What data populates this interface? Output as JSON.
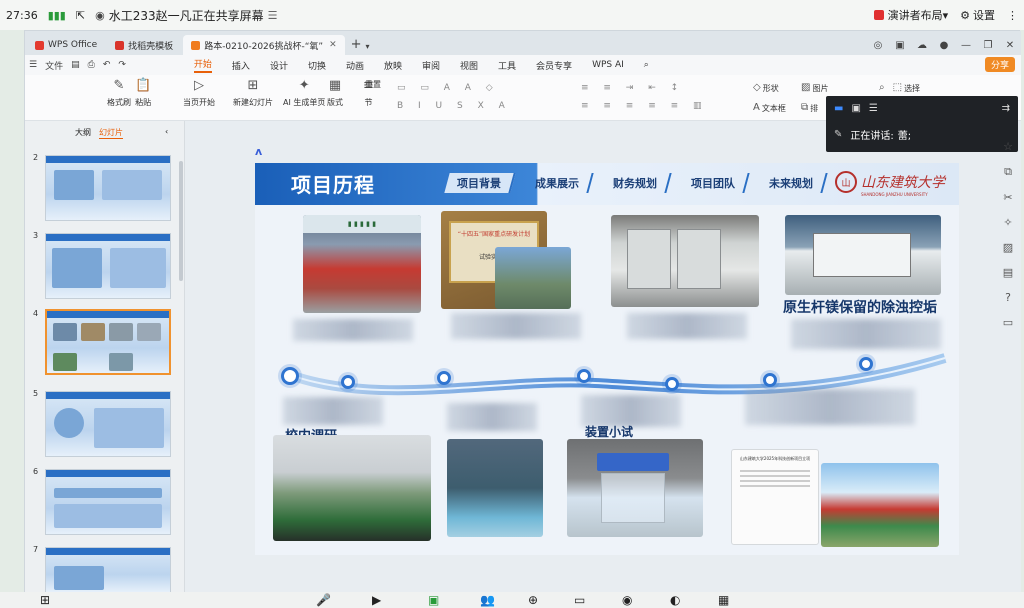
{
  "status_bar": {
    "time": "27:36",
    "signal_icon": "signal-icon",
    "meeting_title": "水工233赵一凡正在共享屏幕",
    "presenter_layout": "演讲者布局",
    "settings": "设置"
  },
  "window": {
    "tabs": [
      {
        "label": "WPS Office",
        "color": "#e33a2f"
      },
      {
        "label": "找稻壳模板",
        "color": "#d9342b"
      },
      {
        "label": "路本-0210-2026挑战杯-“氧”",
        "color": "#f07b1d"
      }
    ],
    "new_tab": "+",
    "menu_left": [
      "文件"
    ],
    "menu": [
      "开始",
      "插入",
      "设计",
      "切换",
      "动画",
      "放映",
      "审阅",
      "视图",
      "工具",
      "会员专享",
      "WPS AI"
    ],
    "active_menu": "开始",
    "share_button": "分享"
  },
  "ribbon": {
    "groups": [
      {
        "label": "格式刷",
        "icon": "brush-icon"
      },
      {
        "label": "粘贴",
        "icon": "paste-icon"
      },
      {
        "label": "当页开始",
        "icon": "play-icon"
      },
      {
        "label": "新建幻灯片",
        "icon": "new-slide-icon"
      },
      {
        "label": "AI 生成单页",
        "icon": "ai-icon"
      },
      {
        "label": "版式",
        "icon": "layout-icon"
      },
      {
        "label": "节",
        "icon": "section-icon"
      },
      {
        "label": "重置",
        "icon": "reset-icon"
      },
      {
        "label": "形状",
        "icon": "shape-icon"
      },
      {
        "label": "图片",
        "icon": "image-icon"
      },
      {
        "label": "文本框",
        "icon": "textbox-icon"
      },
      {
        "label": "排",
        "icon": "arrange-icon"
      },
      {
        "label": "选择",
        "icon": "select-icon"
      }
    ]
  },
  "left_panel": {
    "tabs": [
      "大纲",
      "幻灯片"
    ],
    "active_tab": "幻灯片",
    "slide_numbers": [
      "2",
      "3",
      "4",
      "5",
      "6",
      "7"
    ],
    "selected_slide": "4"
  },
  "slide": {
    "title": "项目历程",
    "nav": [
      "项目背景",
      "成果展示",
      "财务规划",
      "项目团队",
      "未来规划"
    ],
    "university_name_cn": "山东建筑大学",
    "university_name_en": "SHANDONG JIANZHU UNIVERSITY",
    "plaque_text": "“十四五”国家重点研发计划",
    "plaque_sub": "试验实验室",
    "headline_partial": "原生杆镁保留的除浊控垢",
    "text_fragment_left": "校内调研",
    "text_fragment_middle": "装置小试",
    "report_title": "山东建筑大学2025年科技创新项目立项"
  },
  "share_panel": {
    "speaking_label": "正在讲话:",
    "speaker": "蕾;"
  },
  "right_sidebar_icons": [
    "star-icon",
    "copy-icon",
    "scissors-icon",
    "gift-icon",
    "picture-icon",
    "document-icon",
    "help-icon",
    "chat-icon"
  ],
  "bottom_bar_icons": [
    "mic-off-icon",
    "camera-off-icon",
    "share-screen-icon",
    "participants-icon",
    "invite-icon",
    "chat-icon",
    "record-icon",
    "ai-assistant-icon",
    "apps-icon"
  ]
}
